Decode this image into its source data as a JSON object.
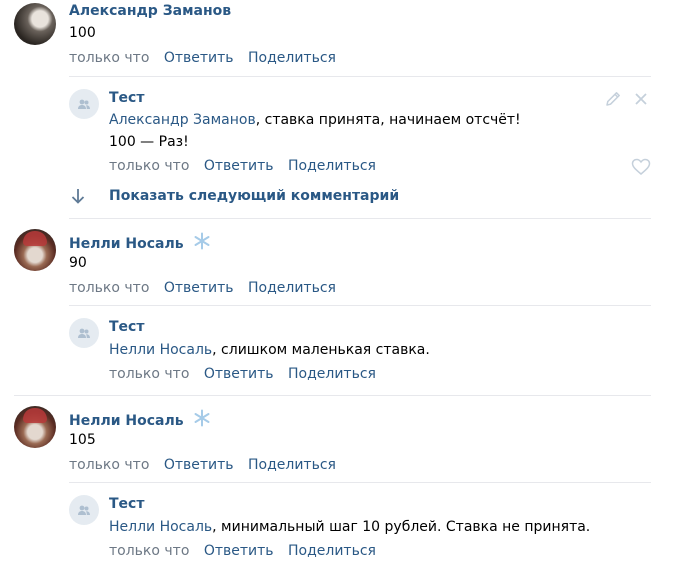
{
  "comments": [
    {
      "author": "Александр Заманов",
      "text": "100",
      "time": "только что",
      "reply_label": "Ответить",
      "share_label": "Поделиться",
      "replies": [
        {
          "author": "Тест",
          "mention": "Александр Заманов",
          "line1": ", ставка принята, начинаем отсчёт!",
          "line2": "100 — Раз!",
          "time": "только что",
          "reply_label": "Ответить",
          "share_label": "Поделиться"
        }
      ]
    },
    {
      "author": "Нелли Носаль",
      "text": "90",
      "time": "только что",
      "reply_label": "Ответить",
      "share_label": "Поделиться",
      "replies": [
        {
          "author": "Тест",
          "mention": "Нелли Носаль",
          "line1": ", слишком маленькая ставка.",
          "time": "только что",
          "reply_label": "Ответить",
          "share_label": "Поделиться"
        }
      ]
    },
    {
      "author": "Нелли Носаль",
      "text": "105",
      "time": "только что",
      "reply_label": "Ответить",
      "share_label": "Поделиться",
      "replies": [
        {
          "author": "Тест",
          "mention": "Нелли Носаль",
          "line1": ", минимальный шаг 10 рублей. Ставка не принята.",
          "time": "только что",
          "reply_label": "Ответить",
          "share_label": "Поделиться"
        }
      ]
    }
  ],
  "show_next_label": "Показать следующий комментарий",
  "icons": {
    "edit": "pencil-icon",
    "close": "close-icon",
    "like": "heart-icon",
    "show_next": "arrow-down-icon",
    "badge": "snowflake-icon",
    "group_avatar": "group-icon"
  },
  "colors": {
    "link": "#2a5885",
    "meta": "#6d7885",
    "separator": "#e7e8ec",
    "icon_gray": "#c5d0db"
  }
}
